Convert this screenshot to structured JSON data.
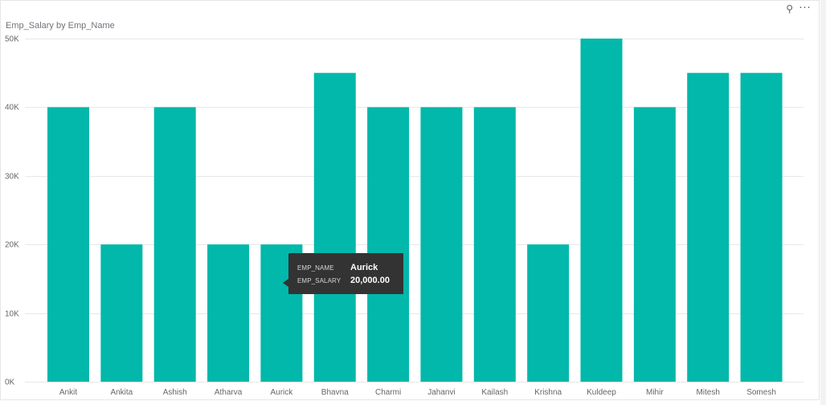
{
  "visual": {
    "title": "Emp_Salary by Emp_Name",
    "icons": {
      "pin": "pin-icon",
      "more": "more-options-icon"
    },
    "pin_glyph": "⚲",
    "more_glyph": "···"
  },
  "tooltip": {
    "name_label": "EMP_NAME",
    "name_value": "Aurick",
    "salary_label": "EMP_SALARY",
    "salary_value": "20,000.00"
  },
  "colors": {
    "bar": "#01b8aa",
    "grid": "#e8e8e8",
    "axis_text": "#666666"
  },
  "chart_data": {
    "type": "bar",
    "title": "Emp_Salary by Emp_Name",
    "xlabel": "",
    "ylabel": "",
    "ylim": [
      0,
      50000
    ],
    "yticks": [
      "0K",
      "10K",
      "20K",
      "30K",
      "40K",
      "50K"
    ],
    "grid": true,
    "categories": [
      "Ankit",
      "Ankita",
      "Ashish",
      "Atharva",
      "Aurick",
      "Bhavna",
      "Charmi",
      "Jahanvi",
      "Kailash",
      "Krishna",
      "Kuldeep",
      "Mihir",
      "Mitesh",
      "Somesh"
    ],
    "values": [
      40000,
      20000,
      40000,
      20000,
      20000,
      45000,
      40000,
      40000,
      40000,
      20000,
      50000,
      40000,
      45000,
      45000
    ]
  }
}
